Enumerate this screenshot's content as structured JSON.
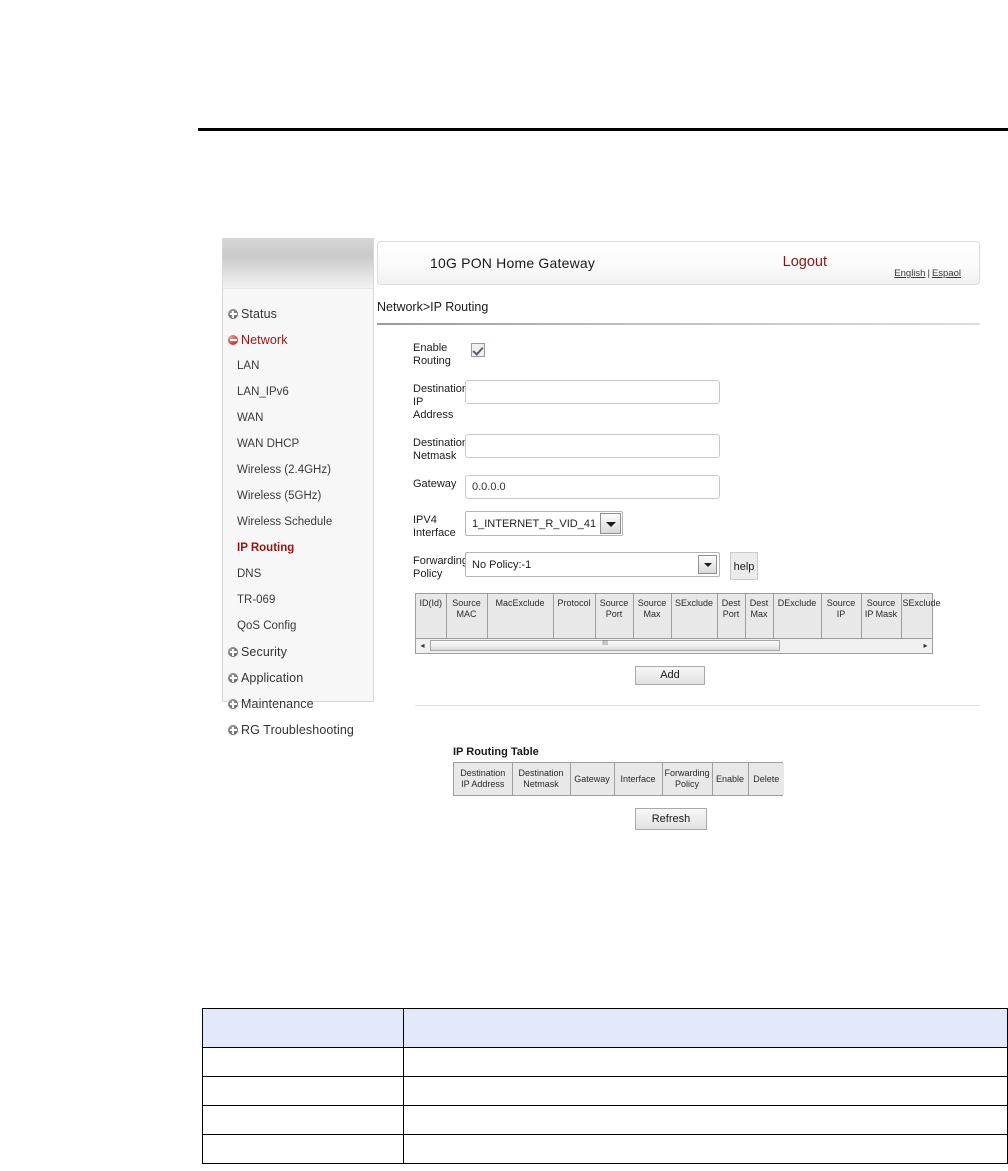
{
  "document": {
    "top_rule": true
  },
  "header": {
    "gateway_title": "10G PON Home Gateway",
    "logout_label": "Logout",
    "lang_english": "English",
    "lang_separator": "|",
    "lang_spanish": "Espaol"
  },
  "breadcrumb": "Network>IP Routing",
  "sidebar": {
    "groups": [
      {
        "label": "Status",
        "icon": "plus-circle-icon",
        "state": "collapsed",
        "active": false
      },
      {
        "label": "Network",
        "icon": "minus-circle-icon",
        "state": "expanded",
        "active": true
      }
    ],
    "network_items": [
      {
        "label": "LAN",
        "current": false
      },
      {
        "label": "LAN_IPv6",
        "current": false
      },
      {
        "label": "WAN",
        "current": false
      },
      {
        "label": "WAN DHCP",
        "current": false
      },
      {
        "label": "Wireless (2.4GHz)",
        "current": false
      },
      {
        "label": "Wireless (5GHz)",
        "current": false
      },
      {
        "label": "Wireless Schedule",
        "current": false
      },
      {
        "label": "IP Routing",
        "current": true
      },
      {
        "label": "DNS",
        "current": false
      },
      {
        "label": "TR-069",
        "current": false
      },
      {
        "label": "QoS Config",
        "current": false
      }
    ],
    "trailing_groups": [
      {
        "label": "Security",
        "icon": "plus-circle-icon",
        "state": "collapsed"
      },
      {
        "label": "Application",
        "icon": "plus-circle-icon",
        "state": "collapsed"
      },
      {
        "label": "Maintenance",
        "icon": "plus-circle-icon",
        "state": "collapsed"
      },
      {
        "label": "RG Troubleshooting",
        "icon": "plus-circle-icon",
        "state": "collapsed"
      }
    ]
  },
  "form": {
    "enable_routing_label": "Enable Routing",
    "enable_routing_checked": true,
    "destination_ip_label": "Destination IP Address",
    "destination_ip_value": "",
    "destination_ip_placeholder": "",
    "destination_netmask_label": "Destination Netmask",
    "destination_netmask_value": "",
    "destination_netmask_placeholder": "",
    "gateway_label": "Gateway",
    "gateway_value": "0.0.0.0",
    "ipv4_interface_label": "IPV4 Interface",
    "ipv4_interface_value": "1_INTERNET_R_VID_41",
    "forwarding_policy_label": "Forwarding Policy",
    "forwarding_policy_value": "No Policy:-1",
    "help_label": "help",
    "add_label": "Add"
  },
  "policy_grid": {
    "columns": [
      "ID(Id)",
      "Source MAC",
      "MacExclude",
      "Protocol",
      "Source Port",
      "Source Max",
      "SExclude",
      "Dest Port",
      "Dest Max",
      "DExclude",
      "Source IP",
      "Source IP Mask",
      "SExclude"
    ],
    "rows": [],
    "scrollbar": {
      "left_arrow": "◂",
      "right_arrow": "▸",
      "grip": "III"
    }
  },
  "routing_table": {
    "title": "IP Routing Table",
    "columns": [
      "Destination IP Address",
      "Destination Netmask",
      "Gateway",
      "Interface",
      "Forwarding Policy",
      "Enable",
      "Delete"
    ],
    "rows": [],
    "refresh_label": "Refresh"
  },
  "bottom_table": {
    "header_row": [
      "",
      ""
    ],
    "rows": [
      [
        "",
        ""
      ],
      [
        "",
        ""
      ],
      [
        "",
        ""
      ],
      [
        "",
        ""
      ]
    ],
    "header_fill": "#e4e8fb"
  },
  "colors": {
    "accent_red": "#9b1212",
    "logout_red": "#8c1414",
    "grid_header": "#e8e8e8",
    "doc_header": "#e4e8fb"
  }
}
